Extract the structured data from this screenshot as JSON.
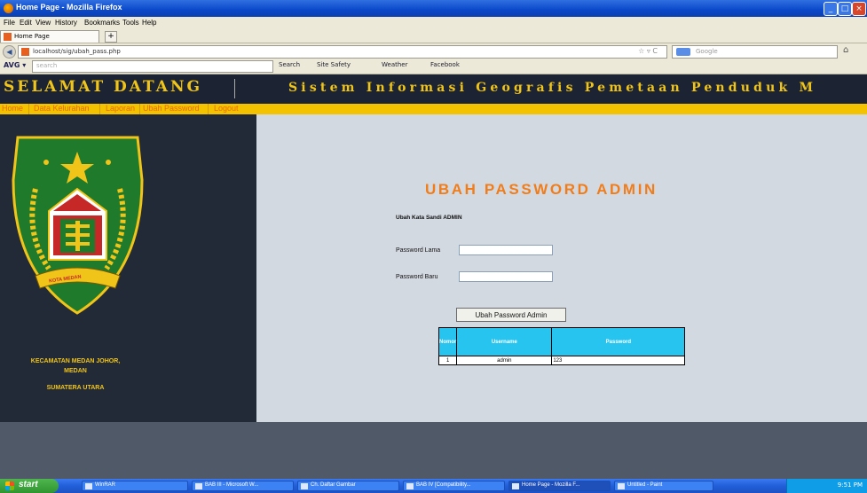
{
  "window": {
    "title": "Home Page - Mozilla Firefox",
    "minimize": "_",
    "maximize": "□",
    "close": "×"
  },
  "menu": [
    "File",
    "Edit",
    "View",
    "History",
    "Bookmarks",
    "Tools",
    "Help"
  ],
  "tab": {
    "label": "Home Page",
    "new_tab": "+"
  },
  "address": {
    "url": "localhost/sig/ubah_pass.php",
    "star": "☆ ▿ C"
  },
  "search": {
    "placeholder": "Google"
  },
  "avg": {
    "logo": "AVG ▾",
    "placeholder": "search",
    "items": [
      "Search",
      "Site Safety",
      "Weather",
      "Facebook"
    ]
  },
  "header": {
    "left": "SELAMAT DATANG",
    "right": "Sistem Informasi Geografis Pemetaan Penduduk M"
  },
  "nav": [
    "Home",
    "Data Kelurahan",
    "Laporan",
    "Ubah Password",
    "Logout"
  ],
  "sidebar": {
    "emblem_label": "KOTA MEDAN",
    "lines": [
      "KECAMATAN MEDAN JOHOR,",
      "MEDAN",
      "SUMATERA UTARA"
    ]
  },
  "form": {
    "title": "UBAH PASSWORD ADMIN",
    "subtitle": "Ubah Kata Sandi ADMIN",
    "old_label": "Password Lama",
    "new_label": "Password Baru",
    "old_value": "",
    "new_value": "",
    "submit": "Ubah Password Admin"
  },
  "table": {
    "headers": [
      "Nomor",
      "Username",
      "Password"
    ],
    "rows": [
      [
        "1",
        "admin",
        "123"
      ]
    ]
  },
  "taskbar": {
    "start": "start",
    "tasks": [
      "WinRAR",
      "BAB III - Microsoft W...",
      "Ch. Daftar Gambar",
      "BAB IV [Compatibility...",
      "Home Page - Mozilla F...",
      "Untitled - Paint"
    ],
    "clock": "9:51 PM"
  },
  "colors": {
    "header_bg": "#1c2433",
    "accent_yellow": "#f0c419",
    "nav_bg": "#f5c200",
    "title_orange": "#f07d1a",
    "table_header": "#27c4ef"
  }
}
